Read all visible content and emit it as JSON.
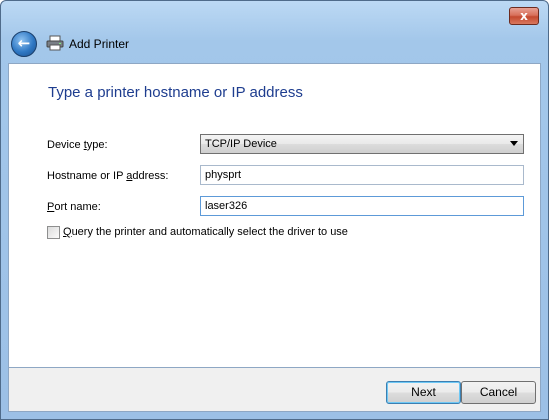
{
  "window": {
    "title": "Add Printer",
    "close_label": "x"
  },
  "page": {
    "heading": "Type a printer hostname or IP address"
  },
  "form": {
    "device_type": {
      "label_pre": "Device ",
      "label_accel": "t",
      "label_post": "ype:",
      "value": "TCP/IP Device"
    },
    "hostname": {
      "label_pre": "Hostname or IP ",
      "label_accel": "a",
      "label_post": "ddress:",
      "value": "physprt"
    },
    "port": {
      "label_pre": "",
      "label_accel": "P",
      "label_post": "ort name:",
      "value": "laser326"
    },
    "query": {
      "label_pre": "",
      "label_accel": "Q",
      "label_post": "uery the printer and automatically select the driver to use",
      "checked": false
    }
  },
  "footer": {
    "next_label": "Next",
    "cancel_label": "Cancel"
  },
  "icons": {
    "back": "back-arrow-icon",
    "printer": "printer-icon",
    "close": "close-icon"
  }
}
